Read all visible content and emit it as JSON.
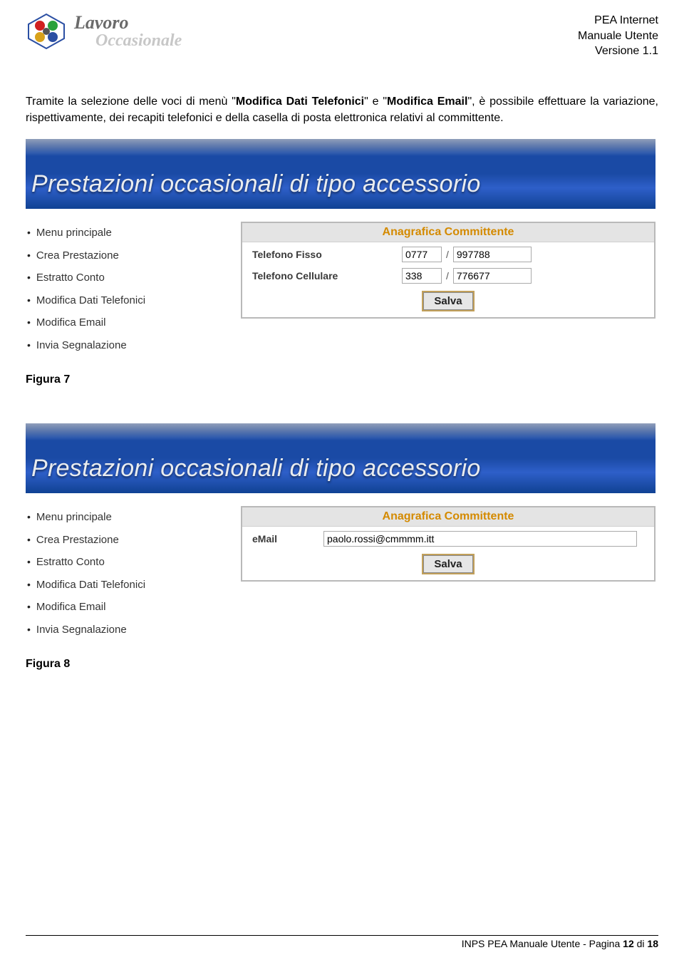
{
  "header": {
    "logo": {
      "line1": "Lavoro",
      "line2": "Occasionale"
    },
    "meta": {
      "l1": "PEA Internet",
      "l2": "Manuale Utente",
      "l3": "Versione 1.1"
    }
  },
  "paragraph": {
    "pre": "Tramite la selezione delle voci di menù \"",
    "b1": "Modifica Dati Telefonici",
    "mid": "\" e \"",
    "b2": "Modifica Email",
    "post": "\", è possibile effettuare la variazione, rispettivamente, dei recapiti telefonici e della casella di posta elettronica relativi al committente."
  },
  "banner_title": "Prestazioni occasionali di tipo accessorio",
  "menu": {
    "items": [
      "Menu principale",
      "Crea Prestazione",
      "Estratto Conto",
      "Modifica Dati Telefonici",
      "Modifica Email",
      "Invia Segnalazione"
    ]
  },
  "fig7": {
    "panel_title": "Anagrafica Committente",
    "row1_label": "Telefono Fisso",
    "row1_prefix": "0777",
    "row1_num": "997788",
    "row2_label": "Telefono Cellulare",
    "row2_prefix": "338",
    "row2_num": "776677",
    "save": "Salva",
    "caption": "Figura 7"
  },
  "fig8": {
    "panel_title": "Anagrafica Committente",
    "row1_label": "eMail",
    "row1_value": "paolo.rossi@cmmmm.itt",
    "save": "Salva",
    "caption": "Figura 8"
  },
  "footer": {
    "text_pre": "INPS  PEA Manuale Utente  -  Pagina ",
    "page_current": "12",
    "text_mid": " di ",
    "page_total": "18"
  }
}
